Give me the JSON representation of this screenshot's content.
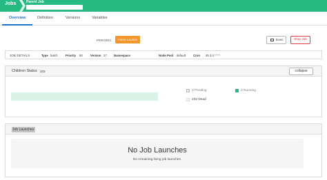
{
  "breadcrumb": {
    "root": "Jobs",
    "parent_label": "Parent Job"
  },
  "tabs": [
    {
      "label": "Overview",
      "active": true
    },
    {
      "label": "Definition",
      "active": false
    },
    {
      "label": "Versions",
      "active": false
    },
    {
      "label": "Variables",
      "active": false
    }
  ],
  "actions": {
    "periodic_label": "PERIODIC",
    "force_launch": "Force Launch",
    "exec": "Exec",
    "stop_job": "Stop Job"
  },
  "job_details": {
    "section_label": "JOB DETAILS",
    "type_key": "Type",
    "type_value": "batch",
    "priority_key": "Priority",
    "priority_value": "50",
    "version_key": "Version",
    "version_value": "27",
    "namespace_key": "Namespace",
    "node_pool_key": "Node Pool",
    "node_pool_value": "default",
    "cron_key": "Cron",
    "cron_value": "45 3,4 * * *"
  },
  "children": {
    "title": "Children Status",
    "count": "232",
    "collapse": "collapse",
    "pending": "0 Pending",
    "running": "0 Running",
    "dead": "232 Dead"
  },
  "launches": {
    "title": "Job Launches",
    "empty_title": "No Job Launches",
    "empty_message": "No remaining living job launches."
  },
  "colors": {
    "brand": "#25ba81",
    "active_tab": "#1b73c9",
    "force_launch": "#f3962b",
    "stop": "#d22f2f",
    "running": "#25ba81",
    "dead_bar": "#d8f2e5"
  },
  "icons": {
    "exec": "terminal-icon"
  }
}
